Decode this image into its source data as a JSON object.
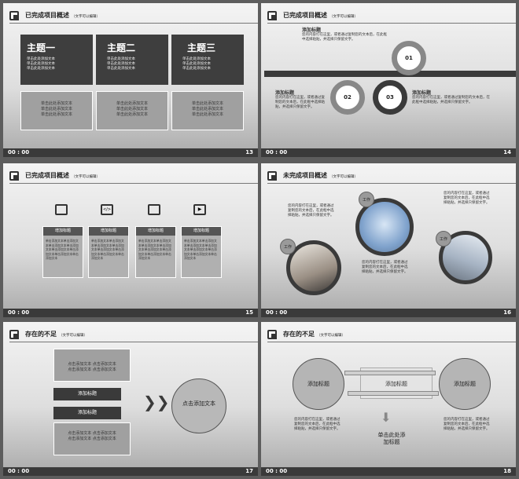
{
  "footer_time": "00 : 00",
  "slide13": {
    "title": "已完成项目概述",
    "subtitle": "（文字可以编辑）",
    "page": "13",
    "topics": [
      {
        "title": "主题一",
        "items": [
          "单击此处添加文本",
          "单击此处添加文本",
          "单击此处添加文本"
        ]
      },
      {
        "title": "主题二",
        "items": [
          "单击此处添加文本",
          "单击此处添加文本",
          "单击此处添加文本"
        ]
      },
      {
        "title": "主题三",
        "items": [
          "单击此处添加文本",
          "单击此处添加文本",
          "单击此处添加文本"
        ]
      }
    ],
    "grey_lines": [
      "单击此处添加文本",
      "单击此处添加文本",
      "单击此处添加文本"
    ]
  },
  "slide14": {
    "title": "已完成项目概述",
    "subtitle": "（文字可以编辑）",
    "page": "14",
    "label": "添加标题",
    "text": "您的内容打在这里，或者通过复制您的文本后，在此框中选择粘贴，并选择只保留文字。",
    "text_short": "您的内容打在这里，或者通过复制您的文本后，在此框中选择粘贴，并选择只保留文字。",
    "nums": [
      "01",
      "02",
      "03"
    ]
  },
  "slide15": {
    "title": "已完成项目概述",
    "subtitle": "（文字可以编辑）",
    "page": "15",
    "col_title": "增加标题",
    "col_text": "单击添加文本单击添加文本单击添加文本单击添加文本单击添加文本单击添加文本单击添加文本单击添加文本"
  },
  "slide16": {
    "title": "未完成项目概述",
    "subtitle": "（文字可以编辑）",
    "page": "16",
    "text": "您的内容打在这里，或者通过复制您的文本后，在此框中选择粘贴，并选择只保留文字。",
    "tag1": "工作",
    "tag2": "工作",
    "tag3": "工作"
  },
  "slide17": {
    "title": "存在的不足",
    "subtitle": "（文字可以编辑）",
    "page": "17",
    "top_text": "点击添加文本 点击添加文本 点击添加文本 点击添加文本",
    "bar1": "添加标题",
    "bar2": "添加标题",
    "bottom_text": "点击添加文本 点击添加文本 点击添加文本 点击添加文本",
    "circle": "点击添加文本"
  },
  "slide18": {
    "title": "存在的不足",
    "subtitle": "（文字可以编辑）",
    "page": "18",
    "left": "添加标题",
    "mid": "添加标题",
    "right": "添加标题",
    "text": "您的内容打在这里，或者通过复制您的文本后，在此框中选择粘贴，并选择只保留文字。",
    "bottom": "单击此处添加标题"
  }
}
